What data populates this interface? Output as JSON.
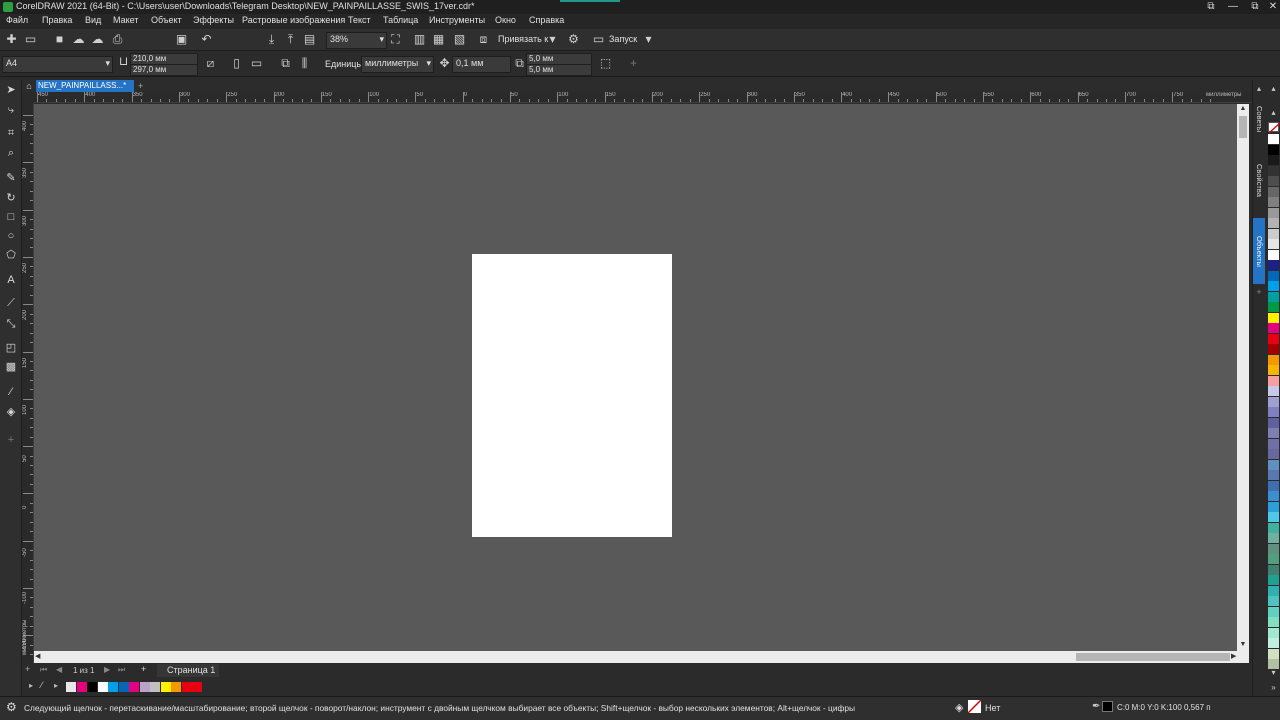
{
  "window": {
    "title": "CorelDRAW 2021 (64-Bit) - C:\\Users\\user\\Downloads\\Telegram Desktop\\NEW_PAINPAILLASSE_SWIS_17ver.cdr*",
    "buttons": [
      "⧉",
      "—",
      "⧉",
      "✕"
    ]
  },
  "menu": [
    "Файл",
    "Правка",
    "Вид",
    "Макет",
    "Объект",
    "Эффекты",
    "Растровые изображения",
    "Текст",
    "Таблица",
    "Инструменты",
    "Окно",
    "Справка"
  ],
  "toolbar": {
    "zoom": "38%",
    "snap_label": "Привязать к",
    "launch_label": "Запуск"
  },
  "propbar": {
    "page_size": "A4",
    "width": "210,0 мм",
    "height": "297,0 мм",
    "units_label": "Единицы:",
    "units_value": "миллиметры",
    "nudge": "0,1 мм",
    "dup_x": "5,0 мм",
    "dup_y": "5,0 мм"
  },
  "tabs": {
    "document": "NEW_PAINPAILLASS...*"
  },
  "ruler": {
    "h_labels": [
      "450",
      "400",
      "350",
      "300",
      "250",
      "200",
      "150",
      "100",
      "50",
      "0",
      "50",
      "100",
      "150",
      "200",
      "250",
      "300",
      "350",
      "400",
      "450",
      "500",
      "550",
      "600",
      "650",
      "700",
      "750"
    ],
    "h_units": "миллиметры",
    "v_labels": [
      "400",
      "350",
      "300",
      "250",
      "200",
      "150",
      "100",
      "50",
      "0",
      "-50",
      "-100",
      "-150"
    ],
    "v_units": "миллиметры"
  },
  "pagenav": {
    "page_counter": "1 из 1",
    "page_tab": "Страница 1"
  },
  "status": {
    "hint": "Следующий щелчок - перетаскивание/масштабирование; второй щелчок - поворот/наклон; инструмент с двойным щелчком выбирает все объекты; Shift+щелчок - выбор нескольких элементов; Alt+щелчок - цифры",
    "fill": "Нет",
    "outline": "C:0 M:0 Y:0 K:100  0,567 п"
  },
  "dockers": [
    "Советы",
    "Свойства",
    "Объекты"
  ],
  "colors": {
    "accent": "#2573c4",
    "canvas": "#595959",
    "page": "#ffffff",
    "doc_palette": [
      "#e8e8e8",
      "#e6007e",
      "#000000",
      "#ffffff",
      "#00a0e9",
      "#0068b7",
      "#e4007f",
      "#b9a3c9",
      "#c0c0c0",
      "#fff100",
      "#f39800",
      "#e60012",
      "#e60012"
    ],
    "palette": [
      "#ffffff",
      "#000000",
      "#1a1a1a",
      "#333333",
      "#4d4d4d",
      "#666666",
      "#808080",
      "#999999",
      "#b3b3b3",
      "#cccccc",
      "#e6e6e6",
      "#ffffff",
      "#1d2088",
      "#0068b7",
      "#00a0e9",
      "#00a0a0",
      "#009944",
      "#fff100",
      "#e4007f",
      "#e60012",
      "#a40000",
      "#f39800",
      "#f8b500",
      "#f5a0a0",
      "#c8c8e8",
      "#a0a0d0",
      "#8080c0",
      "#6060a0",
      "#8080b0",
      "#7070a8",
      "#6868a0",
      "#6090c0",
      "#5a78b0",
      "#3f6fb0",
      "#3b8fd0",
      "#2a9fd8",
      "#50c8e8",
      "#40b0a0",
      "#70b0a0",
      "#609080",
      "#50a080",
      "#408070",
      "#20a090",
      "#30b0b0",
      "#50c0c0",
      "#60d0c0",
      "#80e0c0",
      "#a0e8d0",
      "#c0f0e0",
      "#d0e0c0",
      "#b0c0a0"
    ]
  }
}
